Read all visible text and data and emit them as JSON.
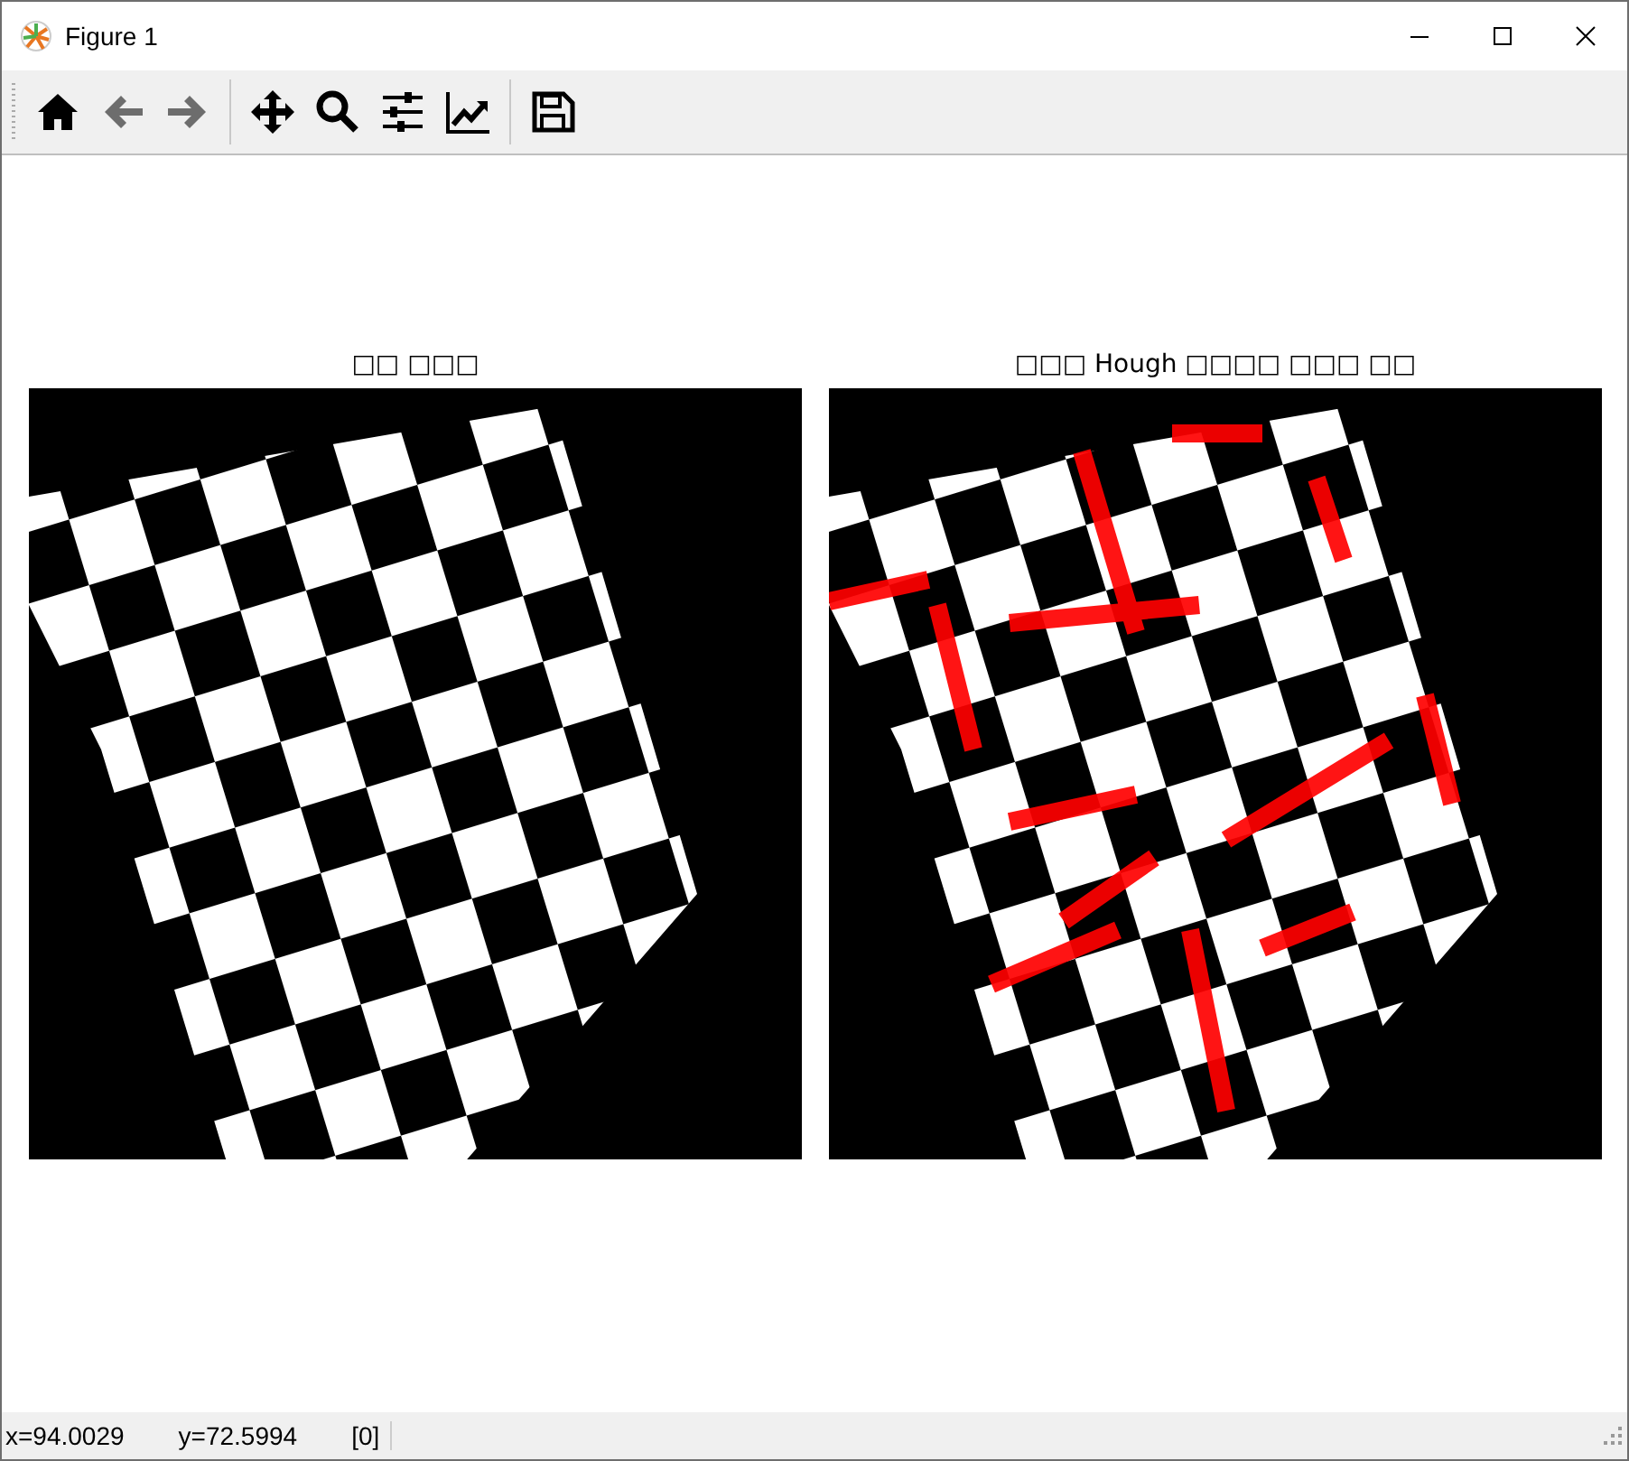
{
  "window": {
    "title": "Figure 1"
  },
  "toolbar": [
    [
      {
        "kind": "home",
        "disabled": false
      },
      {
        "kind": "back",
        "disabled": true
      },
      {
        "kind": "forward",
        "disabled": true
      }
    ],
    [
      {
        "kind": "pan",
        "disabled": false
      },
      {
        "kind": "zoom",
        "disabled": false
      },
      {
        "kind": "subplots",
        "disabled": false
      },
      {
        "kind": "axes",
        "disabled": false
      }
    ],
    [
      {
        "kind": "save",
        "disabled": false
      }
    ]
  ],
  "axes": [
    {
      "title": "□□ □□□",
      "kind": "picture"
    },
    {
      "title": "□□□ Hough □□□□ □□□ □□",
      "kind": "picture"
    }
  ],
  "status_bar": {
    "x": "x=94.0029",
    "y": "y=72.5994",
    "value": "[0]"
  }
}
